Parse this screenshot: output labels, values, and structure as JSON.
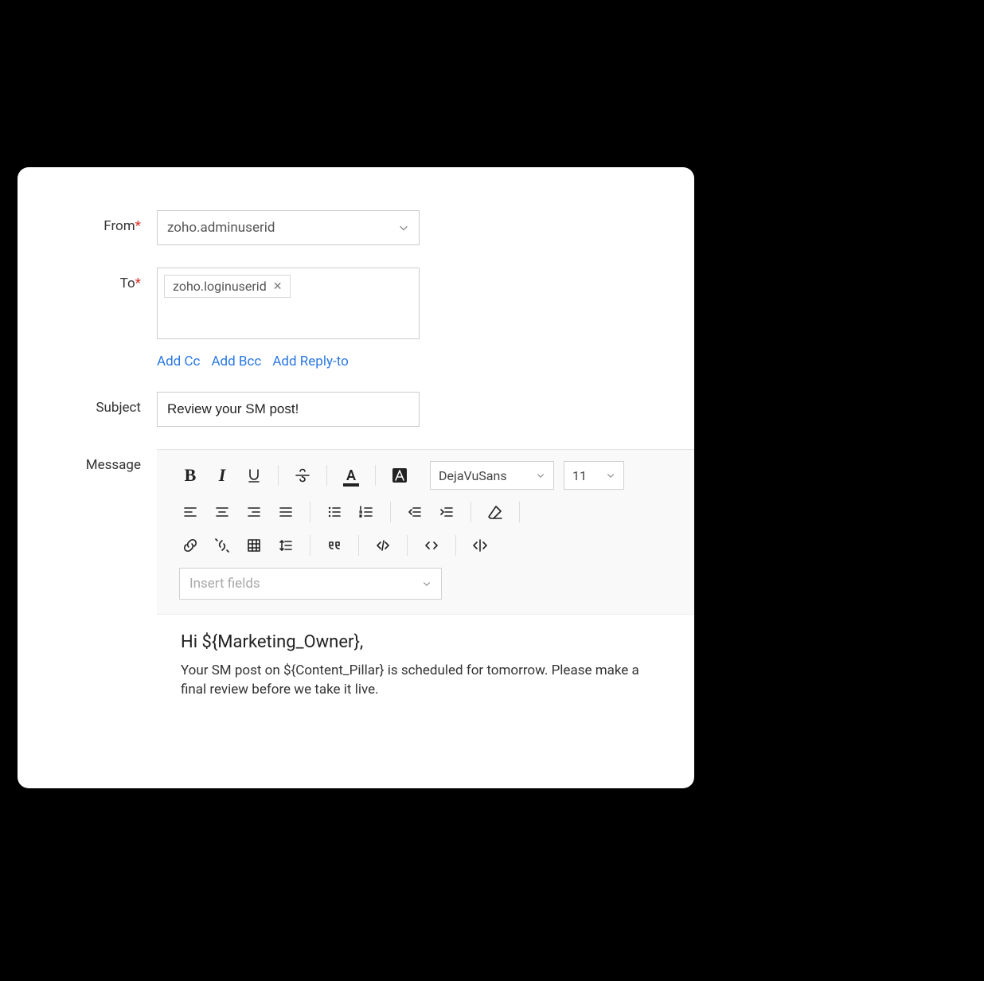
{
  "from": {
    "label": "From",
    "required": "*",
    "value": "zoho.adminuserid"
  },
  "to": {
    "label": "To",
    "required": "*",
    "chip": "zoho.loginuserid"
  },
  "links": {
    "cc": "Add Cc",
    "bcc": "Add Bcc",
    "reply": "Add Reply-to"
  },
  "subject": {
    "label": "Subject",
    "value": "Review your SM post!"
  },
  "message": {
    "label": "Message"
  },
  "toolbar": {
    "font": "DejaVuSans",
    "size": "11",
    "insert_placeholder": "Insert fields"
  },
  "body": {
    "greeting": "Hi ${Marketing_Owner},",
    "paragraph": "Your SM post on ${Content_Pillar} is scheduled for tomorrow. Please make a final review before we take it live."
  }
}
